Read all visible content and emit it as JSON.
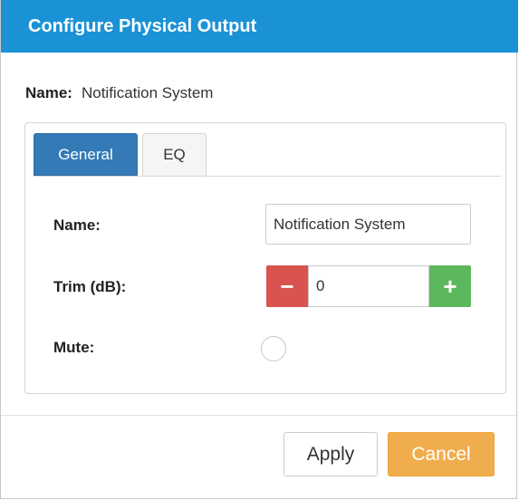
{
  "dialog": {
    "title": "Configure Physical Output",
    "name_label": "Name:",
    "name_value": "Notification System"
  },
  "tabs": [
    {
      "label": "General",
      "active": true
    },
    {
      "label": "EQ",
      "active": false
    }
  ],
  "form": {
    "name_label": "Name:",
    "name_value": "Notification System",
    "trim_label": "Trim (dB):",
    "trim_value": "0",
    "minus_glyph": "−",
    "plus_glyph": "+",
    "mute_label": "Mute:",
    "mute_on": false
  },
  "footer": {
    "apply_label": "Apply",
    "cancel_label": "Cancel"
  },
  "colors": {
    "header": "#1b92d6",
    "tab_active": "#337ab7",
    "minus": "#d9534f",
    "plus": "#5cb85c",
    "cancel": "#f0ad4e"
  }
}
